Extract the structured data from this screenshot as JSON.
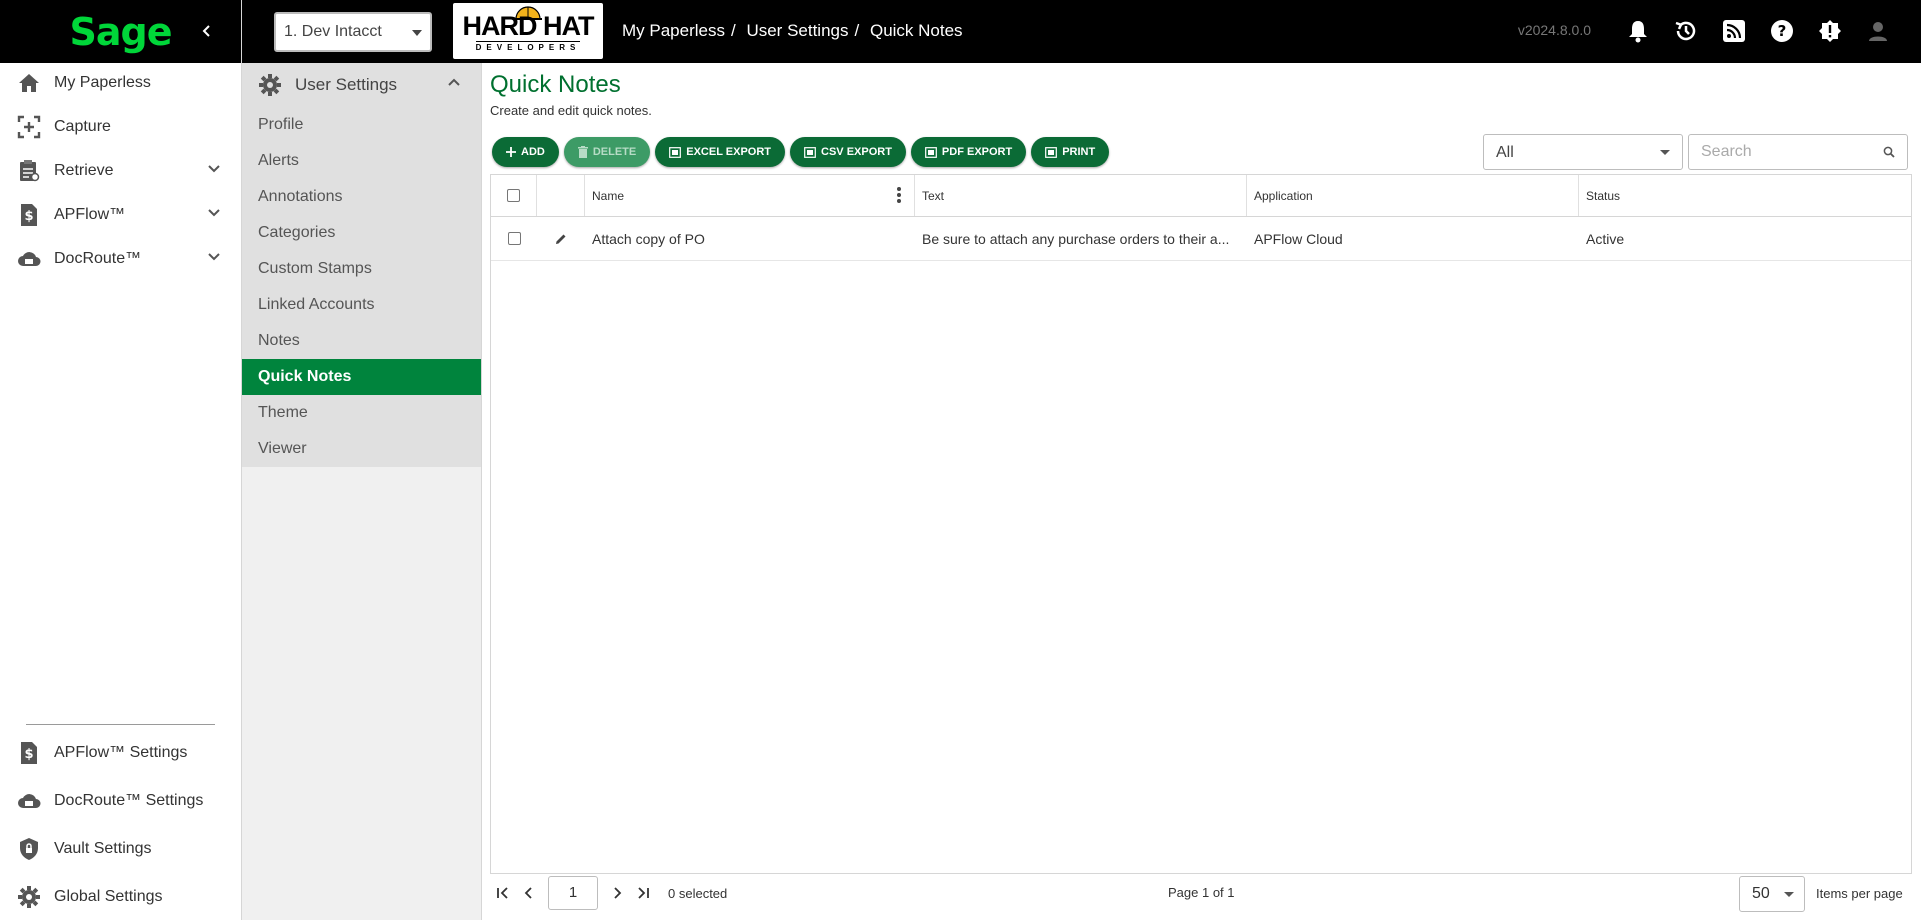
{
  "sidebar": {
    "logo": "Sage",
    "items": [
      {
        "label": "My Paperless",
        "icon": "home-icon"
      },
      {
        "label": "Capture",
        "icon": "capture-icon"
      },
      {
        "label": "Retrieve",
        "icon": "retrieve-icon"
      },
      {
        "label": "APFlow™",
        "icon": "apflow-icon"
      },
      {
        "label": "DocRoute™",
        "icon": "docroute-icon"
      }
    ],
    "bottom_items": [
      {
        "label": "APFlow™ Settings",
        "icon": "apflow-settings-icon"
      },
      {
        "label": "DocRoute™ Settings",
        "icon": "docroute-settings-icon"
      },
      {
        "label": "Vault Settings",
        "icon": "vault-icon"
      },
      {
        "label": "Global Settings",
        "icon": "gear-icon"
      }
    ]
  },
  "header": {
    "company": "1. Dev Intacct",
    "logo_top": "HARD HAT",
    "logo_bottom": "DEVELOPERS",
    "breadcrumb": [
      "My Paperless",
      "User Settings",
      "Quick Notes"
    ],
    "version": "v2024.8.0.0"
  },
  "settings_nav": {
    "title": "User Settings",
    "items": [
      "Profile",
      "Alerts",
      "Annotations",
      "Categories",
      "Custom Stamps",
      "Linked Accounts",
      "Notes",
      "Quick Notes",
      "Theme",
      "Viewer"
    ],
    "active": "Quick Notes"
  },
  "main": {
    "title": "Quick Notes",
    "subtitle": "Create and edit quick notes.",
    "buttons": {
      "add": "ADD",
      "delete": "DELETE",
      "excel": "EXCEL EXPORT",
      "csv": "CSV EXPORT",
      "pdf": "PDF EXPORT",
      "print": "PRINT"
    },
    "filter": "All",
    "search_placeholder": "Search",
    "columns": {
      "name": "Name",
      "text": "Text",
      "application": "Application",
      "status": "Status"
    },
    "rows": [
      {
        "name": "Attach copy of PO",
        "text": "Be sure to attach any purchase orders to their a...",
        "application": "APFlow Cloud",
        "status": "Active"
      }
    ],
    "pager": {
      "page": "1",
      "selected": "0 selected",
      "info": "Page 1 of 1",
      "page_size": "50",
      "page_size_label": "Items per page"
    }
  },
  "colors": {
    "accent": "#00843d",
    "title": "#00702f",
    "sage_green": "#00d639",
    "button": "#0b6b36"
  }
}
